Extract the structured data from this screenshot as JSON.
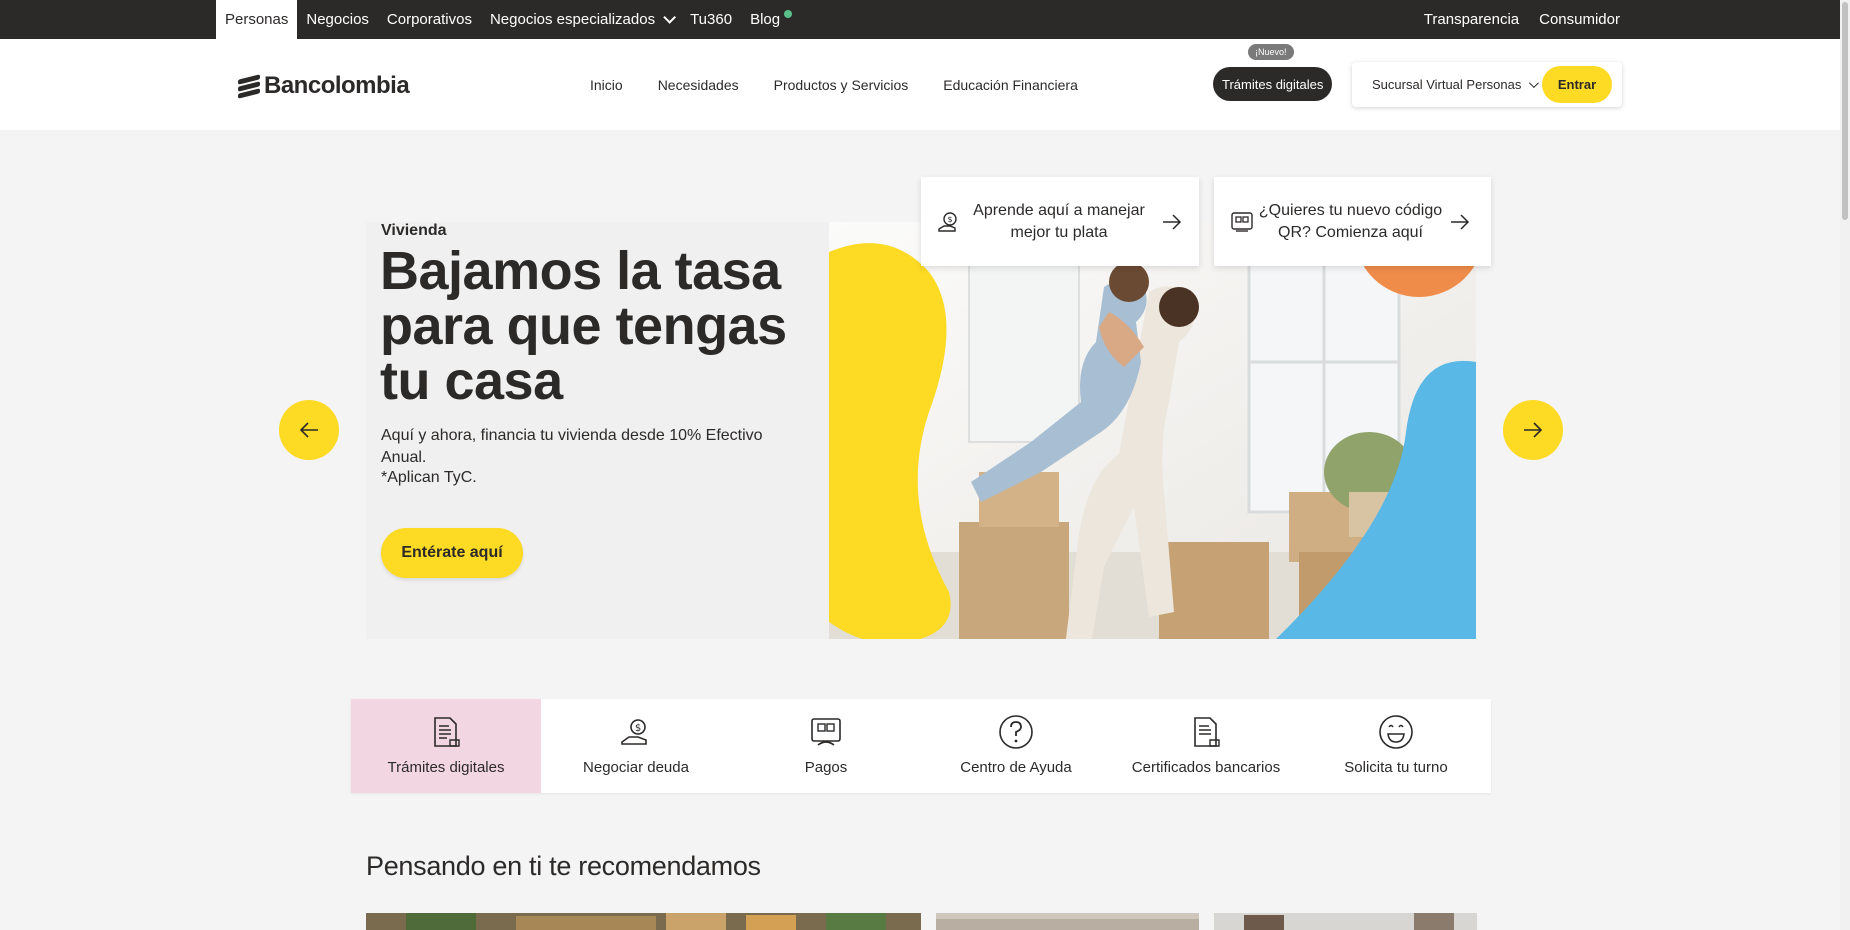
{
  "topbar": {
    "items": [
      {
        "label": "Personas",
        "active": true
      },
      {
        "label": "Negocios"
      },
      {
        "label": "Corporativos"
      },
      {
        "label": "Negocios especializados",
        "dropdown": true
      },
      {
        "label": "Tu360"
      },
      {
        "label": "Blog",
        "dot": true
      }
    ],
    "right": [
      "Transparencia",
      "Consumidor"
    ]
  },
  "header": {
    "logo": "Bancolombia",
    "nav": [
      "Inicio",
      "Necesidades",
      "Productos y Servicios",
      "Educación Financiera"
    ],
    "tramites_label": "Trámites digitales",
    "nuevo_badge": "¡Nuevo!",
    "sucursal_label": "Sucursal Virtual Personas",
    "entrar_label": "Entrar"
  },
  "hero": {
    "eyebrow": "Vivienda",
    "title": "Bajamos la tasa para que tengas tu casa",
    "description": "Aquí y ahora, financia tu vivienda desde 10% Efectivo Anual.",
    "tyc": "*Aplican TyC.",
    "cta": "Entérate aquí",
    "colors": {
      "yellow": "#fdda24",
      "orange": "#f08c4a",
      "blue": "#5ab8e6"
    }
  },
  "quick_cards": [
    {
      "icon": "money-hand-icon",
      "text": "Aprende aquí a manejar mejor tu plata"
    },
    {
      "icon": "qr-code-icon",
      "text": "¿Quieres tu nuevo código QR? Comienza aquí"
    }
  ],
  "carousel": {
    "prev_icon": "arrow-left-icon",
    "next_icon": "arrow-right-icon"
  },
  "shortcuts": [
    {
      "icon": "document-icon",
      "label": "Trámites digitales",
      "active": true
    },
    {
      "icon": "debt-hand-icon",
      "label": "Negociar deuda"
    },
    {
      "icon": "payment-icon",
      "label": "Pagos"
    },
    {
      "icon": "question-icon",
      "label": "Centro de Ayuda"
    },
    {
      "icon": "certificate-icon",
      "label": "Certificados bancarios"
    },
    {
      "icon": "smile-icon",
      "label": "Solicita tu turno"
    }
  ],
  "recommend": {
    "title": "Pensando en ti te recomendamos"
  },
  "colors": {
    "dark": "#2c2a29",
    "yellow": "#fdda24",
    "pink": "#f2d6e2",
    "background": "#f4f4f4"
  }
}
